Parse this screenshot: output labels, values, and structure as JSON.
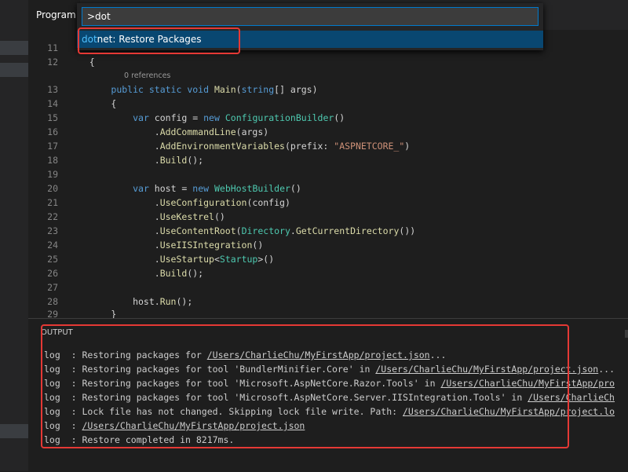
{
  "editor": {
    "tab_label": "Program",
    "codelens": "0 references",
    "line_numbers": [
      "11",
      "12",
      "13",
      "14",
      "15",
      "16",
      "17",
      "18",
      "19",
      "20",
      "21",
      "22",
      "23",
      "24",
      "25",
      "26",
      "27",
      "28",
      "29"
    ]
  },
  "command_palette": {
    "input_value": ">dot",
    "item_match": "dot",
    "item_rest": "net: Restore Packages"
  },
  "output": {
    "title": "OUTPUT",
    "lines": [
      {
        "prefix": "log  : ",
        "text": "Restoring packages for ",
        "path": "/Users/CharlieChu/MyFirstApp/project.json",
        "suffix": "..."
      },
      {
        "prefix": "log  : ",
        "text": "Restoring packages for tool 'BundlerMinifier.Core' in ",
        "path": "/Users/CharlieChu/MyFirstApp/project.json",
        "suffix": "..."
      },
      {
        "prefix": "log  : ",
        "text": "Restoring packages for tool 'Microsoft.AspNetCore.Razor.Tools' in ",
        "path": "/Users/CharlieChu/MyFirstApp/pro",
        "suffix": ""
      },
      {
        "prefix": "log  : ",
        "text": "Restoring packages for tool 'Microsoft.AspNetCore.Server.IISIntegration.Tools' in ",
        "path": "/Users/CharlieCh",
        "suffix": ""
      },
      {
        "prefix": "log  : ",
        "text": "Lock file has not changed. Skipping lock file write. Path: ",
        "path": "/Users/CharlieChu/MyFirstApp/project.lo",
        "suffix": ""
      },
      {
        "prefix": "log  : ",
        "text": "",
        "path": "/Users/CharlieChu/MyFirstApp/project.json",
        "suffix": ""
      },
      {
        "prefix": "log  : ",
        "text": "Restore completed in 8217ms.",
        "path": "",
        "suffix": ""
      }
    ]
  }
}
